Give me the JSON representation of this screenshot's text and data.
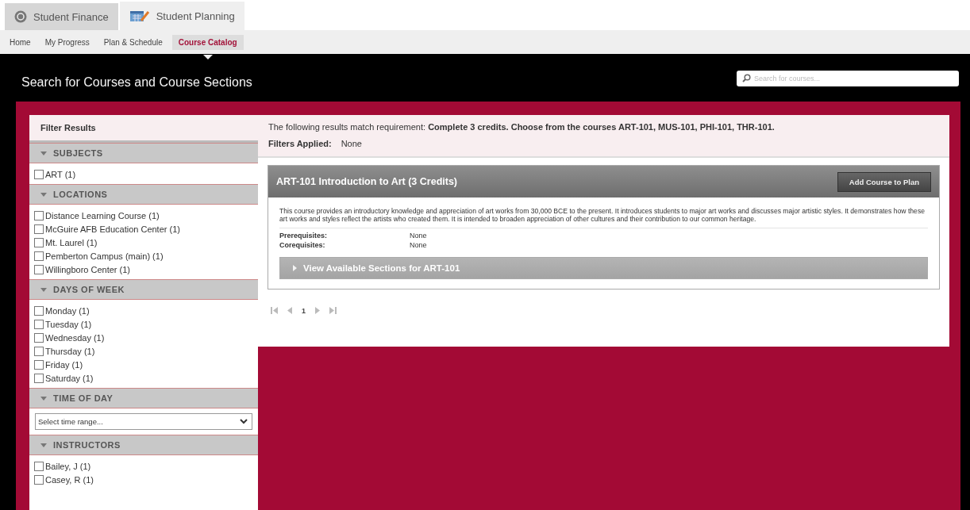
{
  "app_tabs": [
    {
      "label": "Student Finance",
      "selected": false
    },
    {
      "label": "Student Planning",
      "selected": true
    }
  ],
  "subnav": [
    {
      "label": "Home",
      "selected": false
    },
    {
      "label": "My Progress",
      "selected": false
    },
    {
      "label": "Plan & Schedule",
      "selected": false
    },
    {
      "label": "Course Catalog",
      "selected": true
    }
  ],
  "header": {
    "title": "Search for Courses and Course Sections",
    "search": {
      "placeholder": "Search for courses..."
    }
  },
  "filters": {
    "title": "Filter Results",
    "sections": [
      {
        "kind": "checkboxes",
        "title": "SUBJECTS",
        "expanded": true,
        "items": [
          {
            "label": "ART (1)",
            "checked": false
          }
        ]
      },
      {
        "kind": "checkboxes",
        "title": "LOCATIONS",
        "expanded": true,
        "items": [
          {
            "label": "Distance Learning Course (1)",
            "checked": false
          },
          {
            "label": "McGuire AFB Education Center (1)",
            "checked": false
          },
          {
            "label": "Mt. Laurel (1)",
            "checked": false
          },
          {
            "label": "Pemberton Campus (main) (1)",
            "checked": false
          },
          {
            "label": "Willingboro Center (1)",
            "checked": false
          }
        ]
      },
      {
        "kind": "checkboxes",
        "title": "DAYS OF WEEK",
        "expanded": true,
        "items": [
          {
            "label": "Monday (1)",
            "checked": false
          },
          {
            "label": "Tuesday (1)",
            "checked": false
          },
          {
            "label": "Wednesday (1)",
            "checked": false
          },
          {
            "label": "Thursday (1)",
            "checked": false
          },
          {
            "label": "Friday (1)",
            "checked": false
          },
          {
            "label": "Saturday (1)",
            "checked": false
          }
        ]
      },
      {
        "kind": "select",
        "title": "TIME OF DAY",
        "expanded": true,
        "value": "Select time range..."
      },
      {
        "kind": "checkboxes",
        "title": "INSTRUCTORS",
        "expanded": true,
        "items": [
          {
            "label": "Bailey, J (1)",
            "checked": false
          },
          {
            "label": "Casey, R (1)",
            "checked": false
          }
        ]
      }
    ]
  },
  "results": {
    "requirement": "The following results match requirement: **Complete 3 credits. Choose from the courses ART-101, MUS-101, PHI-101, THR-101.**",
    "filters_label": "Filters Applied:",
    "filters_value": "None",
    "courses": [
      {
        "title": "ART-101 Introduction to Art (3 Credits)",
        "button": "Add Course to Plan",
        "description": "This course provides an introductory knowledge and appreciation of art works from 30,000 BCE to the present. It introduces students to major art works and discusses major artistic styles. It demonstrates how these art works and styles reflect the artists who created them. It is intended to broaden appreciation of other cultures and their contribution to our common heritage.",
        "details": [
          {
            "label": "Prerequisites:",
            "value": "None"
          },
          {
            "label": "Corequisites:",
            "value": "None"
          }
        ],
        "sections_toggle": {
          "label": "View Available Sections for ART-101",
          "expanded": false
        }
      }
    ],
    "pagination": {
      "page": "1"
    }
  }
}
